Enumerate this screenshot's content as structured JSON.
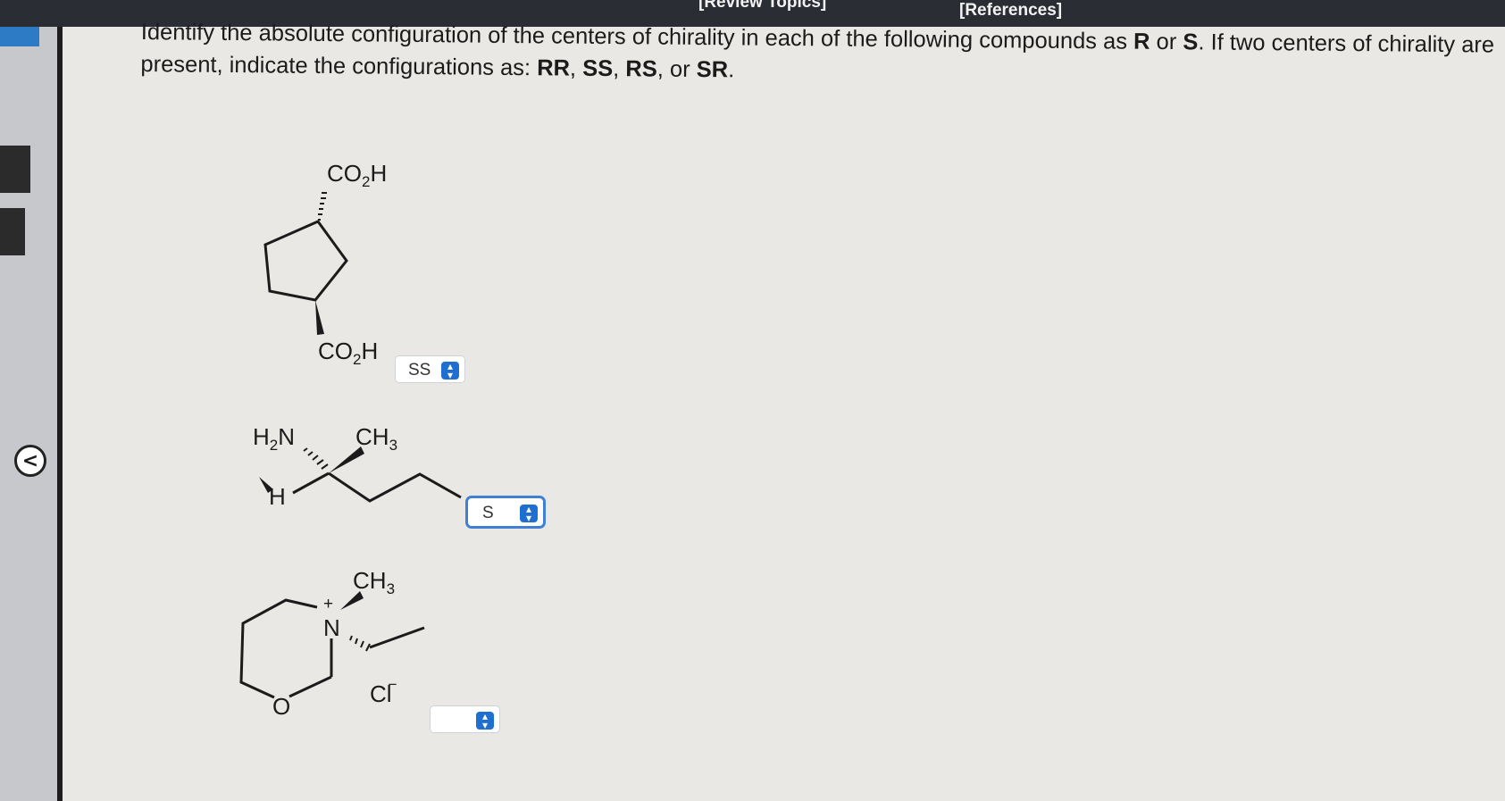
{
  "header": {
    "review_topics": "[Review Topics]",
    "references": "[References]"
  },
  "nav": {
    "question_number": "]",
    "prev_label": "<"
  },
  "question": {
    "part1": "Identify the absolute configuration of the centers of chirality in each of the following compounds as ",
    "r": "R",
    "part2": " or ",
    "s": "S",
    "part3": ". If two centers of chirality are present, indicate the configurations as: ",
    "rr": "RR",
    "c1": ", ",
    "ss": "SS",
    "c2": ", ",
    "rs": "RS",
    "c3": ", or ",
    "sr": "SR",
    "end": "."
  },
  "molecules": {
    "m1": {
      "co2h_top": "CO",
      "sub2_top": "2",
      "h_top": "H",
      "co2h_bottom": "CO",
      "sub2_bottom": "2",
      "h_bottom": "H"
    },
    "m2": {
      "h2n": "H",
      "sub2": "2",
      "n": "N",
      "ch3": "CH",
      "sub3": "3",
      "h": "H"
    },
    "m3": {
      "ch3": "CH",
      "sub3": "3",
      "plus": "+",
      "n": "N",
      "o": "O",
      "cl": "Cl",
      "minus": "−"
    }
  },
  "answers": [
    {
      "value": "SS"
    },
    {
      "value": "S"
    },
    {
      "value": ""
    }
  ],
  "colors": {
    "accent": "#1f6fd1",
    "focus_border": "#3f7fd6",
    "top_bar": "#2a2d33"
  }
}
